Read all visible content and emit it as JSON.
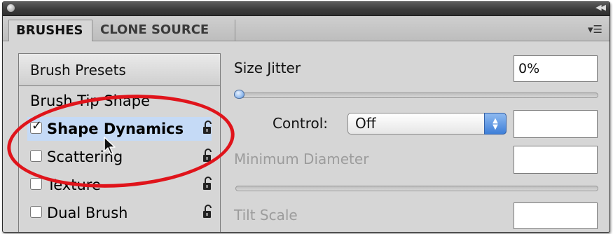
{
  "tabs": [
    {
      "label": "BRUSHES",
      "active": true
    },
    {
      "label": "CLONE SOURCE",
      "active": false
    }
  ],
  "left_panel": {
    "presets_button": "Brush Presets",
    "tip_shape": "Brush Tip Shape",
    "items": [
      {
        "label": "Shape Dynamics",
        "checked": true,
        "selected": true
      },
      {
        "label": "Scattering",
        "checked": false
      },
      {
        "label": "Texture",
        "checked": false
      },
      {
        "label": "Dual Brush",
        "checked": false
      }
    ]
  },
  "settings": {
    "size_jitter_label": "Size Jitter",
    "size_jitter_value": "0%",
    "control_label": "Control:",
    "control_value": "Off",
    "min_diameter_label": "Minimum Diameter",
    "tilt_scale_label": "Tilt Scale"
  },
  "colors": {
    "highlight": "#c5daf6",
    "annotation_red": "#e0141b",
    "disabled_text": "#9c9c9c",
    "panel_bg": "#d6d6d6"
  },
  "icons": [
    "panel-collapse-icon",
    "panel-menu-icon",
    "lock-icon",
    "pointer-cursor-icon",
    "dropdown-arrows-icon"
  ]
}
